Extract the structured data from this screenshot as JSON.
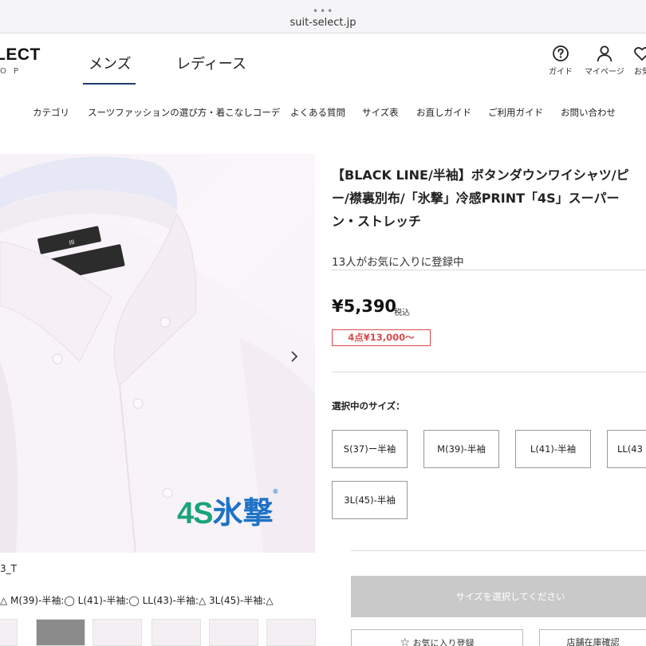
{
  "browser": {
    "dots": "•••",
    "url": "suit-select.jp"
  },
  "header": {
    "logo_main": "LECT",
    "logo_sub": "O P",
    "gnav": [
      "メンズ",
      "レディース"
    ],
    "icons": [
      {
        "icon": "help-icon",
        "label": "ガイド"
      },
      {
        "icon": "user-icon",
        "label": "マイページ"
      },
      {
        "icon": "heart-icon",
        "label": "お気"
      }
    ],
    "subnav": [
      "カテゴリ",
      "スーツファッションの選び方・着こなしコーデ",
      "よくある質問",
      "サイズ表",
      "お直しガイド",
      "ご利用ガイド",
      "お問い合わせ"
    ]
  },
  "gallery": {
    "brand_prefix": "4S",
    "brand_kanji": "氷撃",
    "registered": "®",
    "next_icon": "chevron-right-icon",
    "sku_fragment": "3_T",
    "stock_line": "△  M(39)-半袖:◯  L(41)-半袖:◯  LL(43)-半袖:△  3L(45)-半袖:△",
    "collar_tag": "4S",
    "collar_tag_top": "III",
    "thumbnails": [
      "thumb-1",
      "thumb-2",
      "thumb-3",
      "thumb-4",
      "thumb-5",
      "thumb-6"
    ]
  },
  "product": {
    "title_lines": [
      "【BLACK LINE/半袖】ボタンダウンワイシャツ/ピ",
      "ー/襟裏別布/「氷撃」冷感PRINT「4S」スーパー",
      "ン・ストレッチ"
    ],
    "favorites": "13人がお気に入りに登録中",
    "price": "¥5,390",
    "tax_label": "税込",
    "bundle_offer": "4点¥13,000〜",
    "size_label": "選択中のサイズ：",
    "sizes": [
      "S(37)ー半袖",
      "M(39)-半袖",
      "L(41)-半袖",
      "LL(43",
      "3L(45)-半袖"
    ],
    "cta": "サイズを選択してください",
    "secondary_buttons": [
      "お気に入り登録",
      "店舗在庫確認"
    ]
  },
  "colors": {
    "accent_underline": "#1f3a6d",
    "offer_red": "#d94a4a",
    "brand_green": "#1aa37a",
    "brand_blue": "#1d72c6",
    "cta_disabled": "#c9c9c9"
  }
}
